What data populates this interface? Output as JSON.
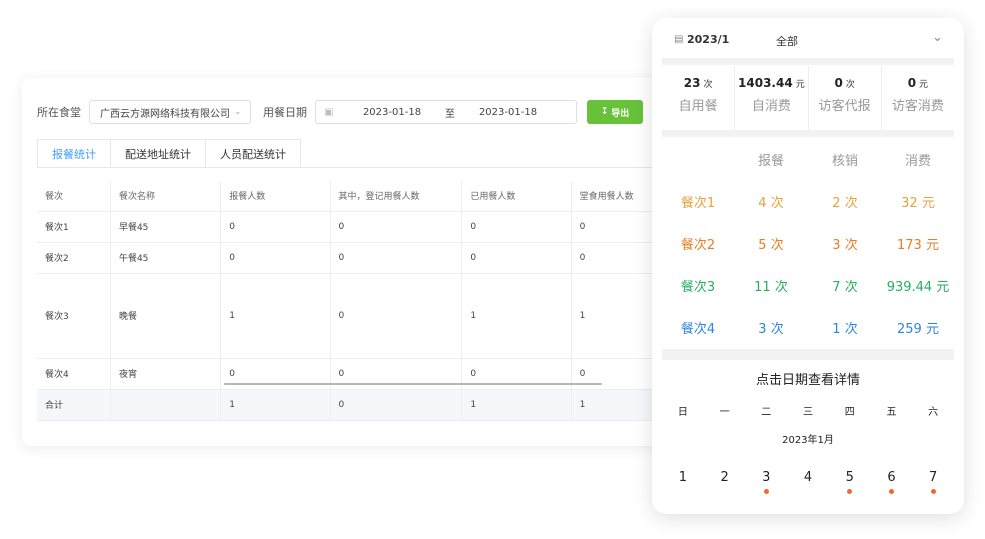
{
  "filters": {
    "canteen_label": "所在食堂",
    "canteen_value": "广西云方源网络科技有限公司",
    "date_label": "用餐日期",
    "date_start": "2023-01-18",
    "date_sep": "至",
    "date_end": "2023-01-18",
    "export_label": "导出"
  },
  "tabs": [
    "报餐统计",
    "配送地址统计",
    "人员配送统计"
  ],
  "table": {
    "headers": [
      "餐次",
      "餐次名称",
      "报餐人数",
      "其中，登记用餐人数",
      "已用餐人数",
      "堂食用餐人数"
    ],
    "rows": [
      [
        "餐次1",
        "早餐45",
        "0",
        "0",
        "0",
        "0"
      ],
      [
        "餐次2",
        "午餐45",
        "0",
        "0",
        "0",
        "0"
      ],
      [
        "餐次3",
        "晚餐",
        "1",
        "0",
        "1",
        "1"
      ],
      [
        "餐次4",
        "夜宵",
        "0",
        "0",
        "0",
        "0"
      ],
      [
        "合计",
        "",
        "1",
        "0",
        "1",
        "1"
      ]
    ]
  },
  "panel": {
    "month": "2023/1",
    "filter": "全部",
    "stats": [
      {
        "value": "23",
        "unit": "次",
        "label": "自用餐"
      },
      {
        "value": "1403.44",
        "unit": "元",
        "label": "自消费"
      },
      {
        "value": "0",
        "unit": "次",
        "label": "访客代报"
      },
      {
        "value": "0",
        "unit": "元",
        "label": "访客消费"
      }
    ],
    "meal_headers": [
      "",
      "报餐",
      "核销",
      "消费"
    ],
    "meals": [
      {
        "name": "餐次1",
        "reported": "4 次",
        "verified": "2 次",
        "spent": "32 元",
        "color": "#e6a23c"
      },
      {
        "name": "餐次2",
        "reported": "5 次",
        "verified": "3 次",
        "spent": "173 元",
        "color": "#e67e22"
      },
      {
        "name": "餐次3",
        "reported": "11 次",
        "verified": "7 次",
        "spent": "939.44 元",
        "color": "#27ae60"
      },
      {
        "name": "餐次4",
        "reported": "3 次",
        "verified": "1 次",
        "spent": "259 元",
        "color": "#2e86de"
      }
    ],
    "calendar_title": "点击日期查看详情",
    "weekdays": [
      "日",
      "一",
      "二",
      "三",
      "四",
      "五",
      "六"
    ],
    "calendar_month": "2023年1月",
    "days": [
      {
        "day": "1",
        "dot": false
      },
      {
        "day": "2",
        "dot": false
      },
      {
        "day": "3",
        "dot": true
      },
      {
        "day": "4",
        "dot": false
      },
      {
        "day": "5",
        "dot": true
      },
      {
        "day": "6",
        "dot": true
      },
      {
        "day": "7",
        "dot": true
      }
    ],
    "dot_color": "#f06a2e"
  }
}
